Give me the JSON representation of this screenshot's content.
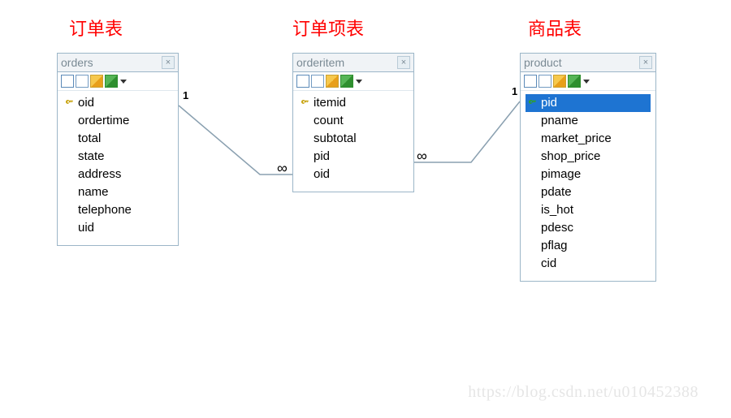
{
  "labels": {
    "orders": "订单表",
    "orderitem": "订单项表",
    "product": "商品表"
  },
  "tables": {
    "orders": {
      "title": "orders",
      "columns": [
        "oid",
        "ordertime",
        "total",
        "state",
        "address",
        "name",
        "telephone",
        "uid"
      ],
      "pk_index": 0,
      "selected_index": -1
    },
    "orderitem": {
      "title": "orderitem",
      "columns": [
        "itemid",
        "count",
        "subtotal",
        "pid",
        "oid"
      ],
      "pk_index": 0,
      "selected_index": -1
    },
    "product": {
      "title": "product",
      "columns": [
        "pid",
        "pname",
        "market_price",
        "shop_price",
        "pimage",
        "pdate",
        "is_hot",
        "pdesc",
        "pflag",
        "cid"
      ],
      "pk_index": 0,
      "pk_green": true,
      "selected_index": 0
    }
  },
  "relations": {
    "orders_orderitem": {
      "left": "1",
      "right": "∞"
    },
    "orderitem_product": {
      "left": "∞",
      "right": "1"
    }
  },
  "watermark": "https://blog.csdn.net/u010452388"
}
